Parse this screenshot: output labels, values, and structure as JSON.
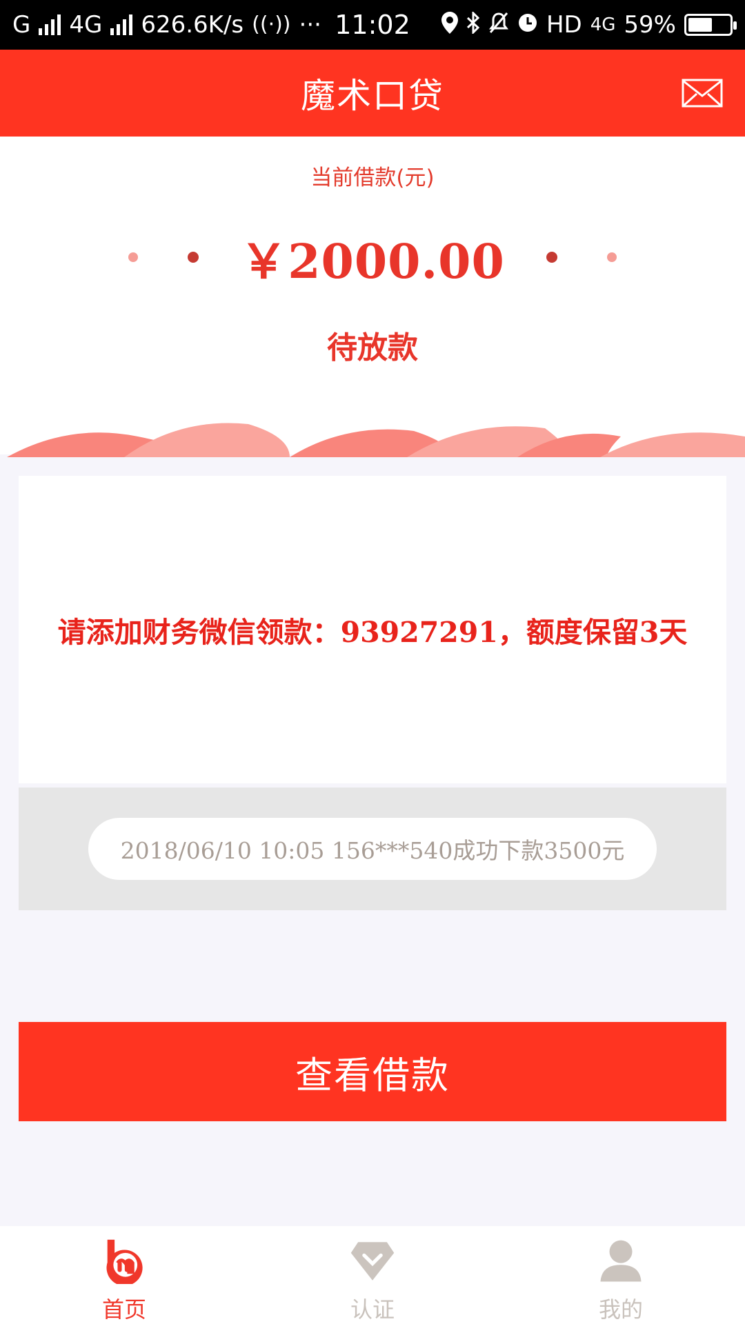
{
  "status_bar": {
    "carrier": "G",
    "network": "4G",
    "speed": "626.6K/s",
    "more": "···",
    "time": "11:02",
    "hd": "HD",
    "net2": "4G",
    "battery": "59%",
    "battery_level": 0.59
  },
  "header": {
    "title": "魔术口贷",
    "mail_icon": "envelope-icon"
  },
  "loan": {
    "caption": "当前借款(元)",
    "amount": "￥2000.00",
    "status": "待放款"
  },
  "notice": {
    "text": "请添加财务微信领款：93927291，额度保留3天"
  },
  "ticker": {
    "text": "2018/06/10 10:05 156***540成功下款3500元"
  },
  "action": {
    "label": "查看借款"
  },
  "nav": {
    "items": [
      {
        "label": "首页",
        "icon": "home-logo-icon",
        "active": true
      },
      {
        "label": "认证",
        "icon": "diamond-check-icon",
        "active": false
      },
      {
        "label": "我的",
        "icon": "user-profile-icon",
        "active": false
      }
    ]
  },
  "colors": {
    "brand": "#ff3421",
    "accent_text": "#e8352a",
    "ticker_text": "#a89d95",
    "nav_inactive": "#c9c2bc"
  }
}
